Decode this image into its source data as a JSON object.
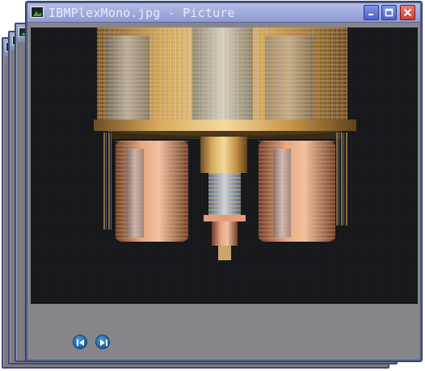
{
  "window": {
    "title": "IBMPlexMono.jpg - Picture",
    "app_icon": "picture-icon",
    "controls": {
      "minimize_icon": "minimize-icon",
      "maximize_icon": "maximize-icon",
      "close_icon": "close-icon"
    }
  },
  "image": {
    "subject": "quantum-computer-chandelier-photo"
  },
  "navigation": {
    "previous_icon": "previous-icon",
    "next_icon": "next-icon"
  },
  "colors": {
    "titlebar": "#8f9bd2",
    "window_frame": "#4a5a8a",
    "body": "#86868a",
    "nav_button": "#1c5d9b",
    "close_button": "#cd3f36"
  }
}
